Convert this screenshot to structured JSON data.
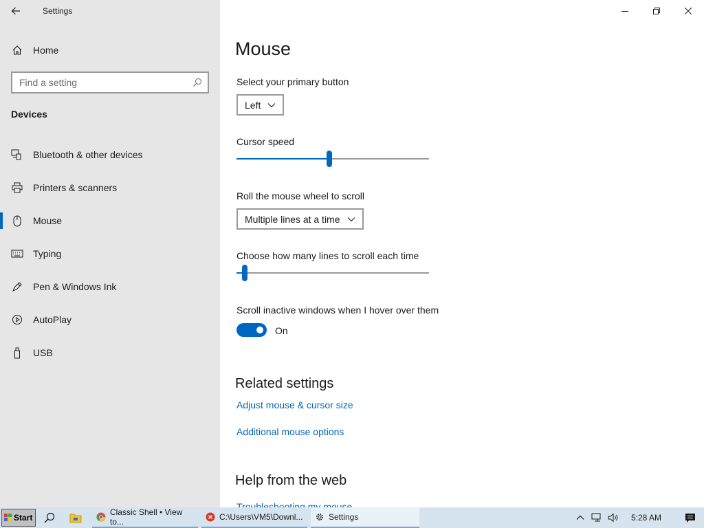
{
  "window": {
    "app_title": "Settings"
  },
  "sidebar": {
    "home_label": "Home",
    "search_placeholder": "Find a setting",
    "section_heading": "Devices",
    "items": [
      {
        "label": "Bluetooth & other devices",
        "icon": "bluetooth-devices-icon",
        "selected": false
      },
      {
        "label": "Printers & scanners",
        "icon": "printer-icon",
        "selected": false
      },
      {
        "label": "Mouse",
        "icon": "mouse-icon",
        "selected": true
      },
      {
        "label": "Typing",
        "icon": "keyboard-icon",
        "selected": false
      },
      {
        "label": "Pen & Windows Ink",
        "icon": "pen-icon",
        "selected": false
      },
      {
        "label": "AutoPlay",
        "icon": "autoplay-icon",
        "selected": false
      },
      {
        "label": "USB",
        "icon": "usb-icon",
        "selected": false
      }
    ]
  },
  "main": {
    "title": "Mouse",
    "primary_button": {
      "label": "Select your primary button",
      "value": "Left"
    },
    "cursor_speed": {
      "label": "Cursor speed",
      "level": 0.48
    },
    "wheel_scroll": {
      "label": "Roll the mouse wheel to scroll",
      "value": "Multiple lines at a time"
    },
    "lines_scroll": {
      "label": "Choose how many lines to scroll each time",
      "level": 0.03
    },
    "inactive_scroll": {
      "label": "Scroll inactive windows when I hover over them",
      "state": "On"
    },
    "related": {
      "heading": "Related settings",
      "links": [
        "Adjust mouse & cursor size",
        "Additional mouse options"
      ]
    },
    "help": {
      "heading": "Help from the web",
      "link": "Troubleshooting my mouse"
    }
  },
  "taskbar": {
    "start_label": "Start",
    "apps": [
      {
        "label": "Classic Shell • View to...",
        "icon": "chrome-icon"
      },
      {
        "label": "C:\\Users\\VM5\\Downl...",
        "icon": "error-icon"
      },
      {
        "label": "Settings",
        "icon": "gear-icon"
      }
    ],
    "clock": "5:28 AM"
  },
  "colors": {
    "accent": "#0067c0",
    "link": "#0067b8",
    "sidebar_bg": "#e6e6e6",
    "taskbar_bg": "#d6e4ef"
  }
}
